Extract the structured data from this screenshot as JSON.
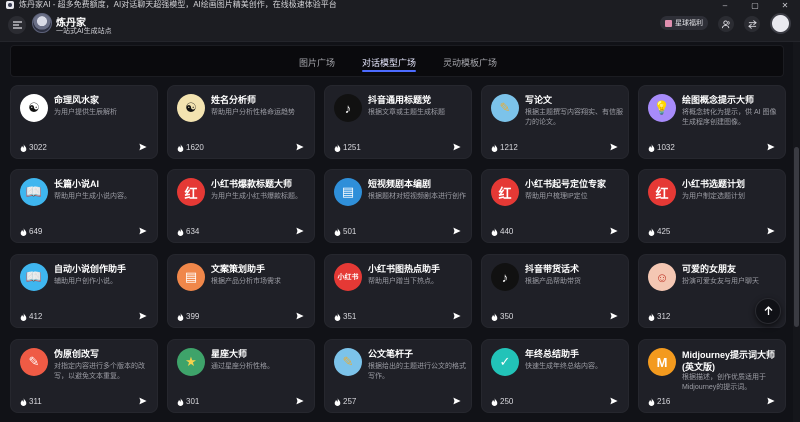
{
  "window": {
    "title": "炼丹家AI - 超多免费额度，AI对话聊天超强模型，AI绘画图片精美创作，在线极速体验平台",
    "controls": [
      "–",
      "▢",
      "✕"
    ]
  },
  "header": {
    "brand_name": "炼丹家",
    "brand_subtitle": "一站式AI生成站点",
    "planet_label": "星球福利"
  },
  "tabs": [
    {
      "label": "图片广场",
      "active": false
    },
    {
      "label": "对话模型广场",
      "active": true
    },
    {
      "label": "灵动模板广场",
      "active": false
    }
  ],
  "cards": [
    {
      "name": "命理风水家",
      "desc": "为用户提供生辰解析",
      "count": "3022",
      "icon": "bagua-icon",
      "icon_bg": "#ffffff",
      "icon_text": "☯",
      "icon_color": "#111111"
    },
    {
      "name": "姓名分析师",
      "desc": "帮助用户分析性格命运趋势",
      "count": "1620",
      "icon": "bagua-icon",
      "icon_bg": "#f3e3b0",
      "icon_text": "☯",
      "icon_color": "#111111"
    },
    {
      "name": "抖音通用标题党",
      "desc": "根据文章或主题生成标题",
      "count": "1251",
      "icon": "tiktok-icon",
      "icon_bg": "#111111",
      "icon_text": "♪",
      "icon_color": "#ffffff"
    },
    {
      "name": "写论文",
      "desc": "根据主题撰写内容翔实、有信服力的论文。",
      "count": "1212",
      "icon": "pencil-icon",
      "icon_bg": "#7cc3ea",
      "icon_text": "✎",
      "icon_color": "#e8ad36"
    },
    {
      "name": "绘图概念提示大师",
      "desc": "将概念转化为提示，供 AI 图像生成程序创建图像。",
      "count": "1032",
      "icon": "lightbulb-icon",
      "icon_bg": "#a78bfa",
      "icon_text": "💡",
      "icon_color": "#ffffff"
    },
    {
      "name": "长篇小说AI",
      "desc": "帮助用户生成小说内容。",
      "count": "649",
      "icon": "book-icon",
      "icon_bg": "#3fb6ef",
      "icon_text": "📖",
      "icon_color": "#ffffff"
    },
    {
      "name": "小红书爆款标题大师",
      "desc": "为用户生成小红书爆款标题。",
      "count": "634",
      "icon": "xiaohongshu-icon",
      "icon_bg": "#e53935",
      "icon_text": "红",
      "icon_color": "#ffffff"
    },
    {
      "name": "短视频剧本编剧",
      "desc": "根据题材对短视频剧本进行创作",
      "count": "501",
      "icon": "document-icon",
      "icon_bg": "#2f8fd9",
      "icon_text": "▤",
      "icon_color": "#ffffff"
    },
    {
      "name": "小红书起号定位专家",
      "desc": "帮助用户梳理IP定位",
      "count": "440",
      "icon": "xiaohongshu-icon",
      "icon_bg": "#e53935",
      "icon_text": "红",
      "icon_color": "#ffffff"
    },
    {
      "name": "小红书选题计划",
      "desc": "为用户制定选题计划",
      "count": "425",
      "icon": "xiaohongshu-icon",
      "icon_bg": "#e53935",
      "icon_text": "红",
      "icon_color": "#ffffff"
    },
    {
      "name": "自动小说创作助手",
      "desc": "辅助用户创作小说。",
      "count": "412",
      "icon": "book-icon",
      "icon_bg": "#3fb6ef",
      "icon_text": "📖",
      "icon_color": "#ffffff"
    },
    {
      "name": "文案策划助手",
      "desc": "根据产品分析市场需求",
      "count": "399",
      "icon": "document-icon",
      "icon_bg": "#f0874a",
      "icon_text": "▤",
      "icon_color": "#ffffff"
    },
    {
      "name": "小红书图热点助手",
      "desc": "帮助用户蹭当下热点。",
      "count": "351",
      "icon": "xiaohongshu-icon",
      "icon_bg": "#e53935",
      "icon_text": "小红书",
      "icon_color": "#ffffff"
    },
    {
      "name": "抖音带货话术",
      "desc": "根据产品帮助带货",
      "count": "350",
      "icon": "tiktok-icon",
      "icon_bg": "#111111",
      "icon_text": "♪",
      "icon_color": "#ffffff"
    },
    {
      "name": "可爱的女朋友",
      "desc": "扮演可爱女友与用户聊天",
      "count": "312",
      "icon": "girl-icon",
      "icon_bg": "#f4c7b3",
      "icon_text": "☺",
      "icon_color": "#c0392b"
    },
    {
      "name": "伪原创改写",
      "desc": "对指定内容进行多个版本的改写，以避免文本重复。",
      "count": "311",
      "icon": "brush-icon",
      "icon_bg": "#ef5b45",
      "icon_text": "✎",
      "icon_color": "#ffffff"
    },
    {
      "name": "星座大师",
      "desc": "通过星座分析性格。",
      "count": "301",
      "icon": "planet-icon",
      "icon_bg": "#3ea36a",
      "icon_text": "★",
      "icon_color": "#f5d24d"
    },
    {
      "name": "公文笔杆子",
      "desc": "根据给出的主题进行公文的格式写作。",
      "count": "257",
      "icon": "pencil-icon",
      "icon_bg": "#7cc3ea",
      "icon_text": "✎",
      "icon_color": "#e8ad36"
    },
    {
      "name": "年终总结助手",
      "desc": "快速生成年终总结内容。",
      "count": "250",
      "icon": "notepad-icon",
      "icon_bg": "#22c3b8",
      "icon_text": "✓",
      "icon_color": "#ffffff"
    },
    {
      "name": "Midjourney提示词大师(英文版)",
      "desc": "根据描述，创作优质适用于Midjourney的提示词。",
      "count": "216",
      "icon": "m-letter-icon",
      "icon_bg": "#f39a1e",
      "icon_text": "M",
      "icon_color": "#ffffff"
    }
  ]
}
